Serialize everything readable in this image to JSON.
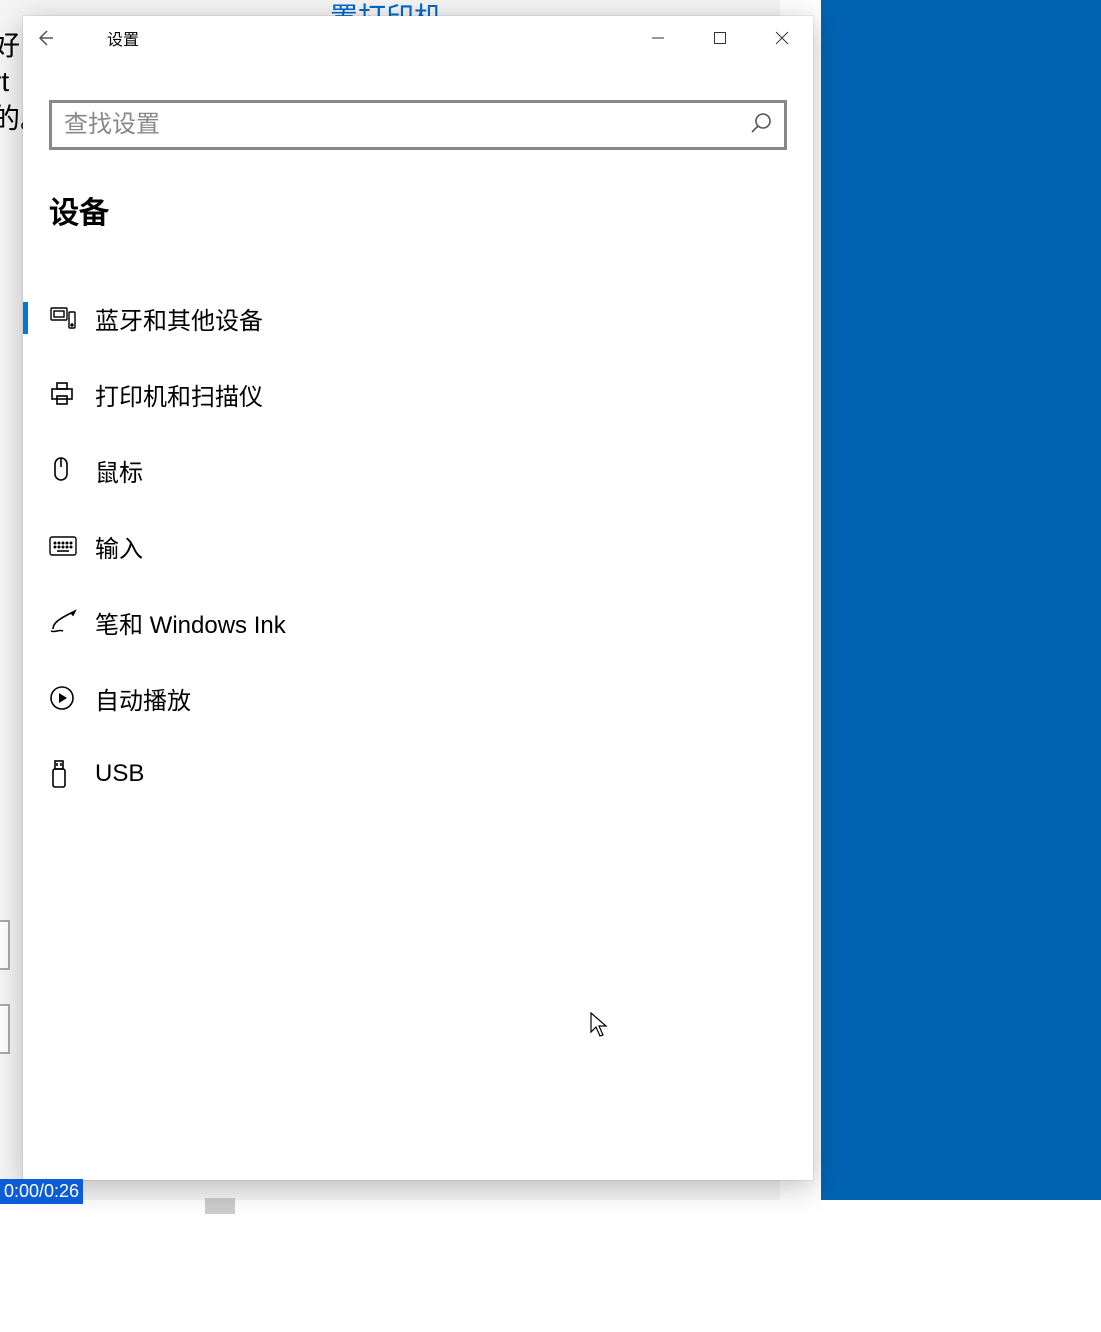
{
  "background": {
    "link_text": "置打印机",
    "left_text": "好\nrt\n的。"
  },
  "window": {
    "title": "设置",
    "search": {
      "placeholder": "查找设置",
      "value": ""
    },
    "section_title": "设备",
    "nav": [
      {
        "label": "蓝牙和其他设备",
        "icon": "bluetooth-devices",
        "selected": true
      },
      {
        "label": "打印机和扫描仪",
        "icon": "printer",
        "selected": false
      },
      {
        "label": "鼠标",
        "icon": "mouse",
        "selected": false
      },
      {
        "label": "输入",
        "icon": "keyboard",
        "selected": false
      },
      {
        "label": "笔和 Windows Ink",
        "icon": "pen",
        "selected": false
      },
      {
        "label": "自动播放",
        "icon": "autoplay",
        "selected": false
      },
      {
        "label": "USB",
        "icon": "usb",
        "selected": false
      }
    ]
  },
  "timecode": "0:00/0:26"
}
